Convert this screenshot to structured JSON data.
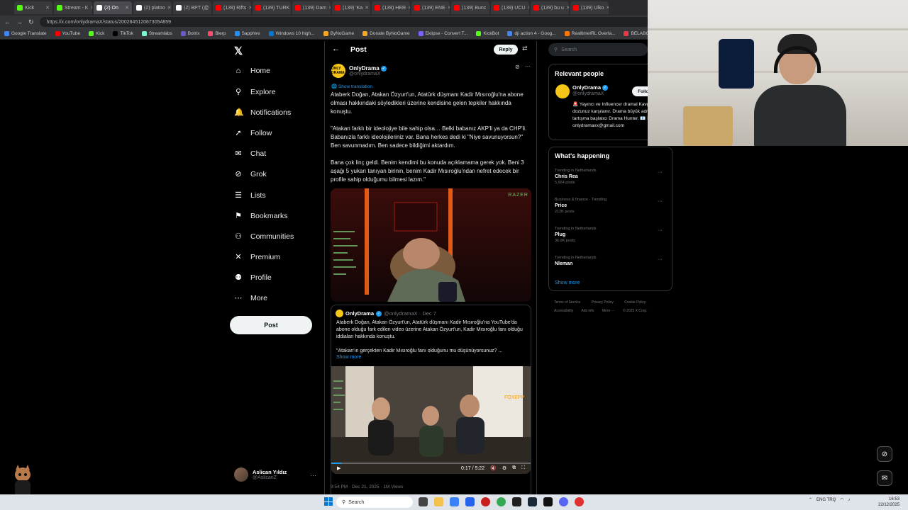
{
  "browser": {
    "tabs": [
      {
        "label": "Kick",
        "color": "#53fc18"
      },
      {
        "label": "Stream - K",
        "color": "#53fc18"
      },
      {
        "label": "(2) On",
        "color": "#ffffff",
        "active": true
      },
      {
        "label": "(2) platoo",
        "color": "#ffffff"
      },
      {
        "label": "(2) BPT (@",
        "color": "#ffffff"
      },
      {
        "label": "(139) Rifts",
        "color": "#ff0000"
      },
      {
        "label": "(139) TURK",
        "color": "#ff0000"
      },
      {
        "label": "(139) Dam",
        "color": "#ff0000"
      },
      {
        "label": "(139) 'Ka",
        "color": "#ff0000"
      },
      {
        "label": "(139) HER",
        "color": "#ff0000"
      },
      {
        "label": "(139) ENE",
        "color": "#ff0000"
      },
      {
        "label": "(139) Bunc",
        "color": "#ff0000"
      },
      {
        "label": "(139) UCU",
        "color": "#ff0000"
      },
      {
        "label": "(139) bu u",
        "color": "#ff0000"
      },
      {
        "label": "(139) Ulko",
        "color": "#ff0000"
      }
    ],
    "url": "https://x.com/onlydramaX/status/2002845120673054859",
    "bookmarks": [
      {
        "label": "Google Translate",
        "color": "#4285f4"
      },
      {
        "label": "YouTube",
        "color": "#ff0000"
      },
      {
        "label": "Kick",
        "color": "#53fc18"
      },
      {
        "label": "TikTok",
        "color": "#000000"
      },
      {
        "label": "Streamlabs",
        "color": "#80f5d2"
      },
      {
        "label": "Botrix",
        "color": "#6a5acd"
      },
      {
        "label": "Blerp",
        "color": "#ff4d6d"
      },
      {
        "label": "Sapphire",
        "color": "#1e90ff"
      },
      {
        "label": "Windows 10 high...",
        "color": "#0078d4"
      },
      {
        "label": "ByNoGame",
        "color": "#f5a623"
      },
      {
        "label": "Donate ByNoGame",
        "color": "#f5a623"
      },
      {
        "label": "Eklipse - Convert T...",
        "color": "#7b61ff"
      },
      {
        "label": "KickBot",
        "color": "#53fc18"
      },
      {
        "label": "dji action 4 - Goog...",
        "color": "#4285f4"
      },
      {
        "label": "RealtimeIRL Overla...",
        "color": "#ff7a00"
      },
      {
        "label": "BELABOX",
        "color": "#e63946"
      }
    ]
  },
  "sidebar": {
    "items": [
      {
        "label": "Home",
        "icon": "home-icon",
        "glyph": "⌂"
      },
      {
        "label": "Explore",
        "icon": "search-icon",
        "glyph": "⚲"
      },
      {
        "label": "Notifications",
        "icon": "bell-icon",
        "glyph": "🔔"
      },
      {
        "label": "Follow",
        "icon": "person-plus-icon",
        "glyph": "➚"
      },
      {
        "label": "Chat",
        "icon": "mail-icon",
        "glyph": "✉"
      },
      {
        "label": "Grok",
        "icon": "grok-icon",
        "glyph": "⊘"
      },
      {
        "label": "Lists",
        "icon": "list-icon",
        "glyph": "☰"
      },
      {
        "label": "Bookmarks",
        "icon": "bookmark-icon",
        "glyph": "⚑"
      },
      {
        "label": "Communities",
        "icon": "people-icon",
        "glyph": "⚇"
      },
      {
        "label": "Premium",
        "icon": "x-icon",
        "glyph": "✕"
      },
      {
        "label": "Profile",
        "icon": "profile-icon",
        "glyph": "⚉"
      },
      {
        "label": "More",
        "icon": "more-icon",
        "glyph": "⋯"
      }
    ],
    "post_label": "Post",
    "user": {
      "name": "Aslican Yıldız",
      "handle": "@AslicanZ"
    }
  },
  "post_header": {
    "title": "Post",
    "reply_label": "Reply"
  },
  "post": {
    "author": "OnlyDrama",
    "handle": "@onlydramaX",
    "avatar_text": "ONLY DRAMA",
    "translate": "Show translation",
    "paragraphs": [
      "Ataberk Doğan, Atakan Özyurt'un, Atatürk düşmanı Kadir Mısıroğlu'na abone olması hakkındaki söyledikleri üzerine kendisine gelen tepkiler hakkında konuştu.",
      "\"Atakan farklı bir ideolojiye bile sahip olsa… Belki babanız AKP'li ya da CHP'li. Babanızla farklı ideolojileriniz var. Bana herkes dedi ki \"Niye savunuyorsun?\" Ben savunmadım. Ben sadece bildiğimi aktardım.",
      "Bana çok linç geldi. Benim kendimi bu konuda açıklamama gerek yok. Beni 3 aşağı 5 yukarı tanıyan birinin, benim Kadir Mısıroğlu'ndan nefret edecek bir profile sahip olduğumu bilmesi lazım.\""
    ],
    "watermark": "RAZER",
    "meta": "9:54 PM · Dec 21, 2025 · 1M Views"
  },
  "quote": {
    "author": "OnlyDrama",
    "handle_date": "@onlydramaX · Dec 7",
    "paragraphs": [
      "Ataberk Doğan, Atakan Özyurt'un, Atatürk düşmanı Kadir Mısıroğlu'na YouTube'da abone olduğu fark edilen video üzerine Atakan Özyurt'un, Kadir Mısıroğlu fanı olduğu iddiaları hakkında konuştu.",
      "\"Atakan'ın gerçekten Kadir Mısıroğlu fanı olduğunu mu düşünüyorsunuz? ..."
    ],
    "show_more": "Show more",
    "video_time": "0:17 / 5:22"
  },
  "right": {
    "search_placeholder": "Search",
    "relevant_title": "Relevant people",
    "person": {
      "name": "OnlyDrama",
      "handle": "@onlydramaX",
      "follow_label": "Follo",
      "bio": "🚨 Yayıncı ve Influencer dramal Kavga dozunuz karşılanır. Drama büyük adresi, tartışma başlatıcı Drama Hunter. 📧 İletişim: onlydramaxx@gmail.com"
    },
    "happening_title": "What's happening",
    "trends": [
      {
        "category": "Trending in Netherlands",
        "name": "Chris Rea",
        "count": "5,664 posts"
      },
      {
        "category": "Business & finance · Trending",
        "name": "Price",
        "count": "212K posts"
      },
      {
        "category": "Trending in Netherlands",
        "name": "Plug",
        "count": "36.9K posts"
      },
      {
        "category": "Trending in Netherlands",
        "name": "Nleman",
        "count": ""
      }
    ],
    "show_more": "Show more",
    "footer_line1": [
      "Terms of Service",
      "Privacy Policy",
      "Cookie Policy"
    ],
    "footer_line2": [
      "Accessibility",
      "Ads info",
      "More ···",
      "© 2025 X Corp."
    ]
  },
  "taskbar": {
    "search_placeholder": "Search",
    "tray_lang": "ENG TRQ",
    "time": "16:53",
    "date": "22/12/2025"
  }
}
